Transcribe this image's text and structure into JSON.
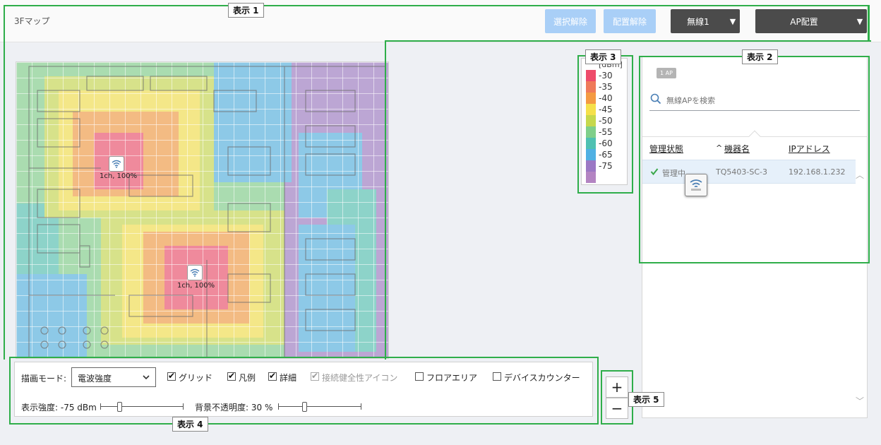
{
  "topbar": {
    "title": "3Fマップ",
    "deselect_label": "選択解除",
    "unplace_label": "配置解除",
    "wireless_dropdown": "無線1",
    "ap_place_dropdown": "AP配置"
  },
  "map": {
    "aps": [
      {
        "label": "1ch, 100%"
      },
      {
        "label": "1ch, 100%"
      }
    ]
  },
  "legend": {
    "unit": "[dBm]",
    "items": [
      {
        "value": "-30",
        "color": "#ee4b6a"
      },
      {
        "value": "-35",
        "color": "#ef7a5a"
      },
      {
        "value": "-40",
        "color": "#f49a42"
      },
      {
        "value": "-45",
        "color": "#f5e04a"
      },
      {
        "value": "-50",
        "color": "#c6d84c"
      },
      {
        "value": "-55",
        "color": "#7fcf8a"
      },
      {
        "value": "-60",
        "color": "#4fc1b2"
      },
      {
        "value": "-65",
        "color": "#4fb0e3"
      },
      {
        "value": "-75",
        "color": "#9b78c4"
      },
      {
        "value": "",
        "color": "#b384c2"
      }
    ]
  },
  "panel": {
    "ap_count": "1 AP",
    "search_placeholder": "無線APを検索",
    "headers": {
      "status": "管理状態",
      "name": "機器名",
      "ip": "IPアドレス",
      "sort_indicator": "^"
    },
    "rows": [
      {
        "status": "管理中",
        "name": "TQ5403-SC-3",
        "ip": "192.168.1.232"
      }
    ]
  },
  "controls": {
    "draw_mode_label": "描画モード:",
    "draw_mode_value": "電波強度",
    "grid_label": "グリッド",
    "legend_label": "凡例",
    "detail_label": "詳細",
    "health_icon_label": "接続健全性アイコン",
    "floor_area_label": "フロアエリア",
    "device_counter_label": "デバイスカウンター",
    "strength_label": "表示強度: -75 dBm",
    "opacity_label": "背景不透明度: 30 %",
    "strength_value_dbm": -75,
    "opacity_percent": 30
  },
  "zoom": {
    "plus": "+",
    "minus": "−"
  },
  "callouts": {
    "c1": "表示 1",
    "c2": "表示 2",
    "c3": "表示 3",
    "c4": "表示 4",
    "c5": "表示 5"
  },
  "colors": {
    "accent_green": "#2fae4a",
    "button_light": "#a9cff7",
    "button_dark": "#4b4b4b",
    "row_selected": "#e6f0fa"
  }
}
